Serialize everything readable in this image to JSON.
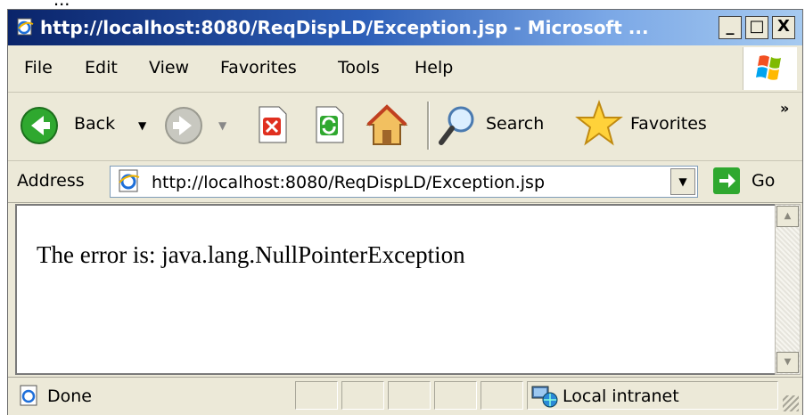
{
  "caption_fragment": "...",
  "window": {
    "title": "http://localhost:8080/ReqDispLD/Exception.jsp - Microsoft ...",
    "controls": {
      "minimize": "_",
      "maximize": "□",
      "close": "X"
    }
  },
  "menu": {
    "items": [
      "File",
      "Edit",
      "View",
      "Favorites",
      "Tools",
      "Help"
    ]
  },
  "toolbar": {
    "back_label": "Back",
    "search_label": "Search",
    "favorites_label": "Favorites",
    "overflow": "»"
  },
  "address_bar": {
    "label": "Address",
    "url": "http://localhost:8080/ReqDispLD/Exception.jsp",
    "go_label": "Go"
  },
  "page": {
    "message": "The error is: java.lang.NullPointerException"
  },
  "status_bar": {
    "status": "Done",
    "zone": "Local intranet"
  },
  "colors": {
    "titlebar_start": "#0a246a",
    "titlebar_end": "#a6caf0",
    "chrome": "#ece9d8",
    "back_green": "#2fa82f"
  },
  "icons": [
    "ie-page-icon",
    "back-arrow-icon",
    "forward-arrow-icon",
    "stop-icon",
    "refresh-icon",
    "home-icon",
    "search-magnifier-icon",
    "favorites-star-icon",
    "go-arrow-icon",
    "windows-logo-icon",
    "local-intranet-icon"
  ]
}
